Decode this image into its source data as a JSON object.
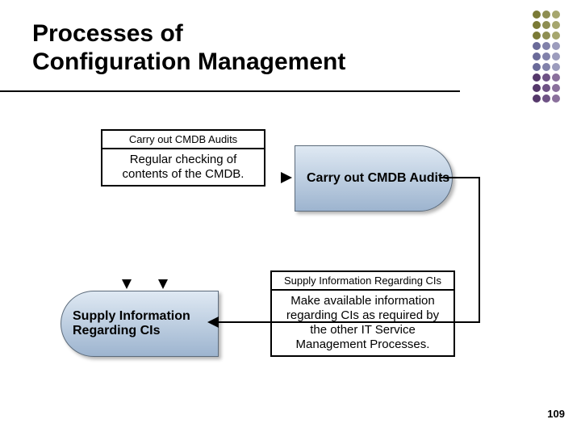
{
  "title_line1": "Processes of",
  "title_line2": "Configuration Management",
  "callout_a": {
    "title": "Carry out CMDB Audits",
    "body": "Regular checking of contents of the CMDB."
  },
  "callout_b": {
    "title": "Supply Information Regarding CIs",
    "body": "Make available information regarding CIs as required by the other IT Service Management Processes."
  },
  "process1": "Carry out CMDB Audits",
  "process2": "Supply Information Regarding CIs",
  "page_number": "109"
}
